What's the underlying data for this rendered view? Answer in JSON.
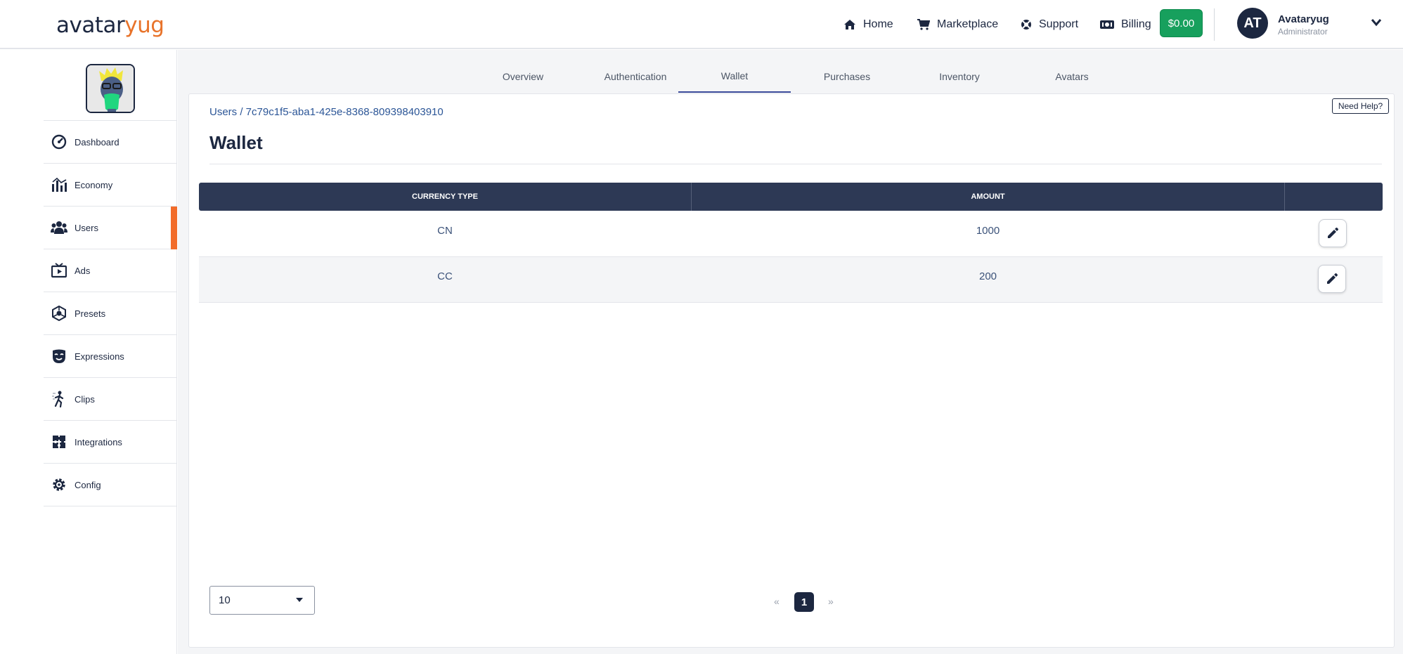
{
  "brand": {
    "logo_part1": "avatar",
    "logo_part2": "yug"
  },
  "topnav": {
    "home": "Home",
    "marketplace": "Marketplace",
    "support": "Support",
    "billing": "Billing",
    "balance": "$0.00"
  },
  "user": {
    "initials": "AT",
    "name": "Avataryug",
    "role": "Administrator"
  },
  "sidebar": {
    "items": [
      {
        "label": "Dashboard",
        "icon": "dashboard-gauge-icon"
      },
      {
        "label": "Economy",
        "icon": "economy-chart-icon"
      },
      {
        "label": "Users",
        "icon": "users-icon",
        "active": true
      },
      {
        "label": "Ads",
        "icon": "ads-icon"
      },
      {
        "label": "Presets",
        "icon": "presets-icon"
      },
      {
        "label": "Expressions",
        "icon": "expressions-mask-icon"
      },
      {
        "label": "Clips",
        "icon": "clips-figure-icon"
      },
      {
        "label": "Integrations",
        "icon": "integrations-puzzle-icon"
      },
      {
        "label": "Config",
        "icon": "config-gear-icon"
      }
    ]
  },
  "tabs": [
    {
      "label": "Overview"
    },
    {
      "label": "Authentication"
    },
    {
      "label": "Wallet",
      "active": true
    },
    {
      "label": "Purchases"
    },
    {
      "label": "Inventory"
    },
    {
      "label": "Avatars"
    }
  ],
  "help_label": "Need Help?",
  "breadcrumb": "Users / 7c79c1f5-aba1-425e-8368-809398403910",
  "page_title": "Wallet",
  "table": {
    "headers": [
      "CURRENCY TYPE",
      "AMOUNT",
      ""
    ],
    "rows": [
      {
        "currency": "CN",
        "amount": "1000"
      },
      {
        "currency": "CC",
        "amount": "200"
      }
    ]
  },
  "pagination": {
    "page_size": "10",
    "prev": "«",
    "current": "1",
    "next": "»"
  },
  "colors": {
    "accent": "#f26c2a",
    "navy": "#1c2740",
    "balance_green": "#17a05d",
    "tab_active": "#3b4a9a"
  }
}
